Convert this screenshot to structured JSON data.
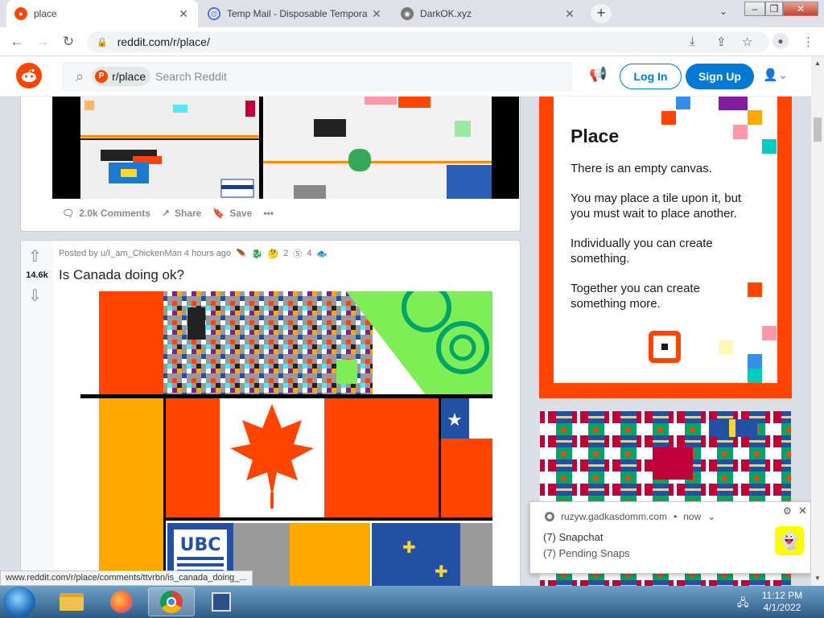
{
  "browser": {
    "tabs": [
      {
        "title": "place",
        "active": true,
        "icon": "reddit-icon"
      },
      {
        "title": "Temp Mail - Disposable Tempora",
        "active": false,
        "icon": "at-icon"
      },
      {
        "title": "DarkOK.xyz",
        "active": false,
        "icon": "globe-icon"
      }
    ],
    "url": "reddit.com/r/place/"
  },
  "reddit": {
    "search_chip": "r/place",
    "search_placeholder": "Search Reddit",
    "login_label": "Log In",
    "signup_label": "Sign Up"
  },
  "first_post": {
    "comments": "2.0k Comments",
    "share": "Share",
    "save": "Save",
    "more": "•••"
  },
  "second_post": {
    "posted_by": "Posted by u/I_am_ChickenMan 4 hours ago",
    "award_count_1": "2",
    "award_count_2": "4",
    "votes": "14.6k",
    "title": "Is Canada doing ok?"
  },
  "sidebar": {
    "heading": "Place",
    "p1": "There is an empty canvas.",
    "p2": "You may place a tile upon it, but you must wait to place another.",
    "p3": "Individually you can create something.",
    "p4": "Together you can create something more."
  },
  "notification": {
    "source": "ruzyw.gadkasdomm.com",
    "time": "now",
    "line1": "(7) Snapchat",
    "line2": "(7) Pending Snaps"
  },
  "status_url": "www.reddit.com/r/place/comments/ttvrbn/is_canada_doing_...",
  "clock": {
    "time": "11:12 PM",
    "date": "4/1/2022"
  },
  "colors": {
    "reddit_orange": "#ff4500",
    "reddit_blue": "#0079d3",
    "canada_red": "#ff4500"
  }
}
